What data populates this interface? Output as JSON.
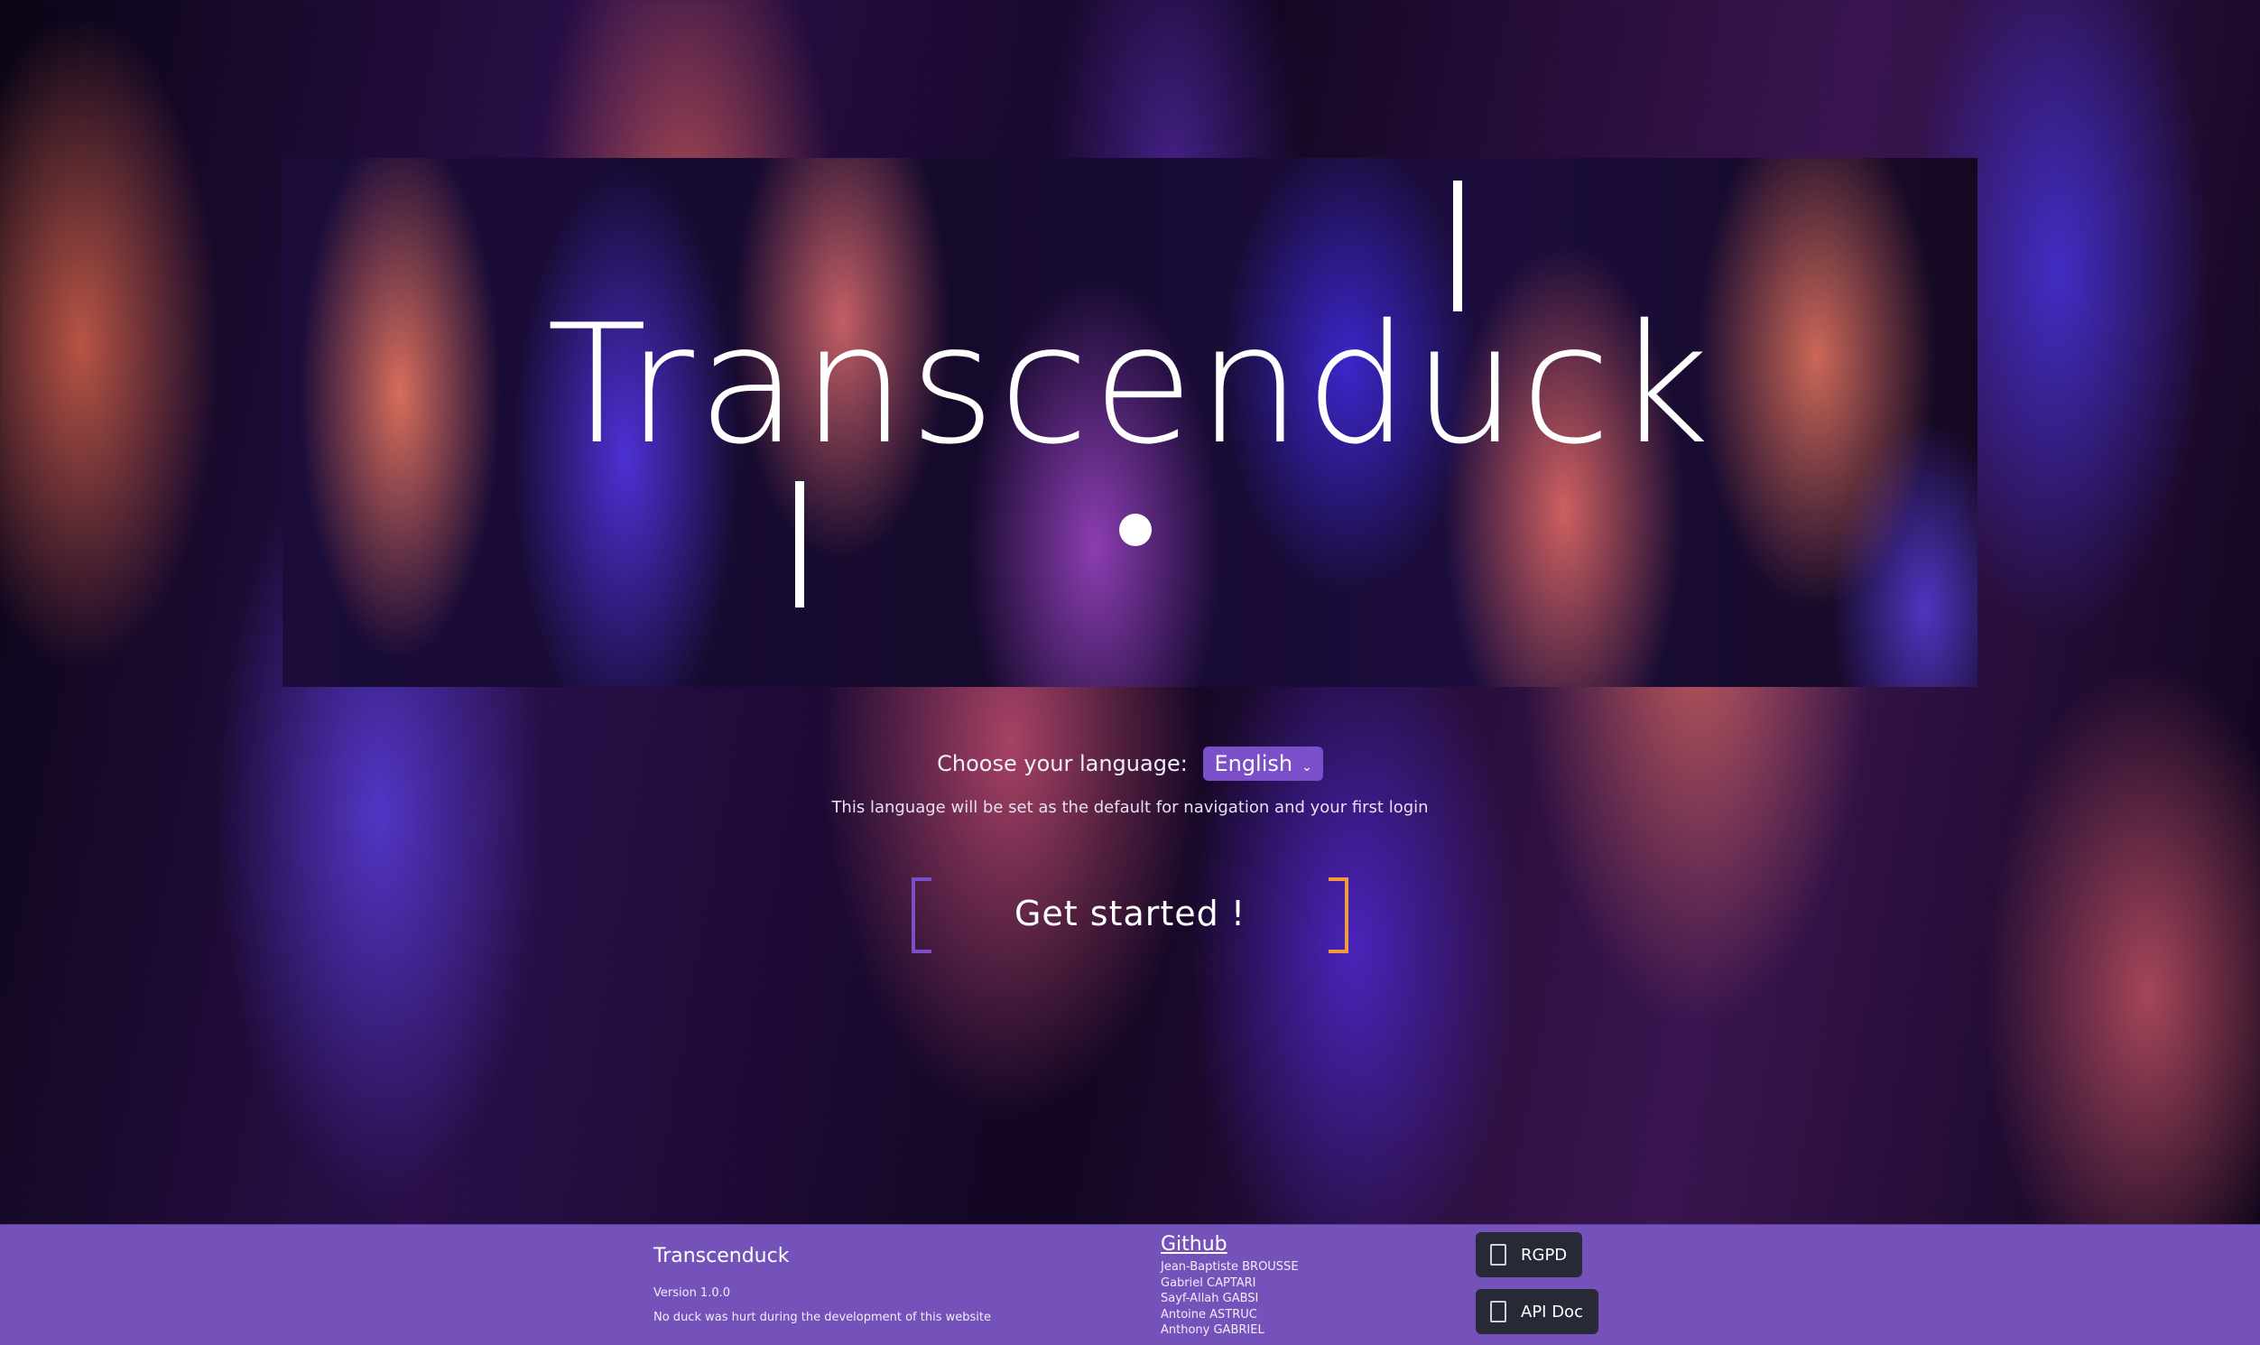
{
  "hero": {
    "title": "Transcenduck"
  },
  "language": {
    "label": "Choose your language:",
    "selected": "English",
    "note": "This language will be set as the default for navigation and your first login"
  },
  "cta": {
    "label": "Get started !"
  },
  "footer": {
    "brand": "Transcenduck",
    "version": "Version 1.0.0",
    "tagline": "No duck was hurt during the development of this website",
    "github_label": "Github",
    "contributors": [
      "Jean-Baptiste BROUSSE",
      "Gabriel CAPTARI",
      "Sayf-Allah GABSI",
      "Antoine ASTRUC",
      "Anthony GABRIEL"
    ],
    "buttons": {
      "rgpd": "RGPD",
      "api_doc": "API Doc"
    }
  },
  "colors": {
    "footer_bg": "#7552ba",
    "select_bg": "#7a4fc9",
    "bracket_left": "#7a4fc9",
    "bracket_right": "#f19a3e",
    "footer_button_bg": "#272a36"
  }
}
